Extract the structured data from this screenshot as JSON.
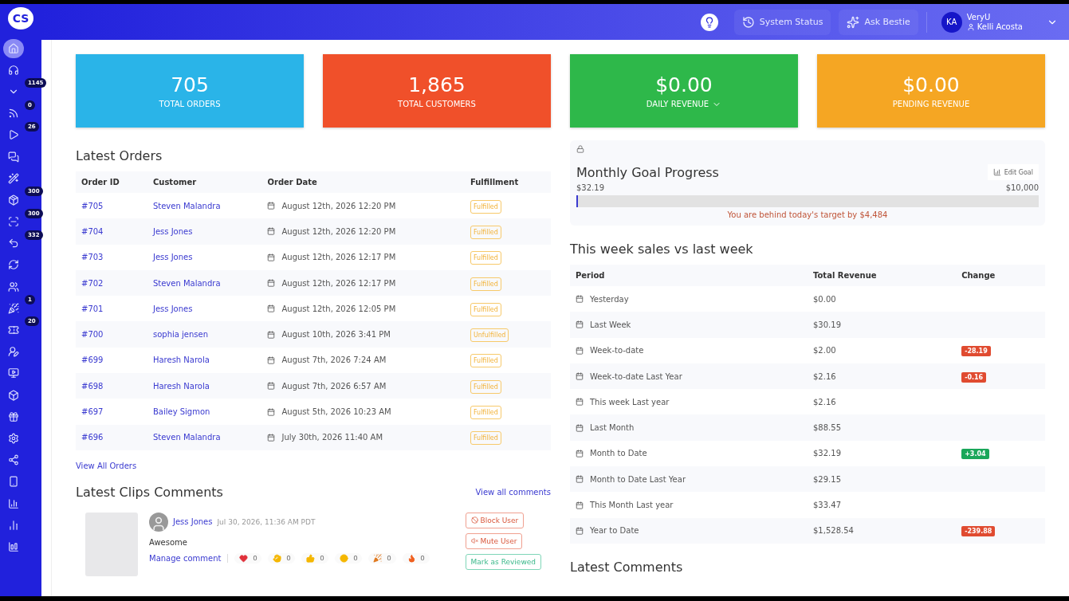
{
  "header": {
    "system_status": "System Status",
    "ask": "Ask Bestie",
    "user": {
      "initials": "KA",
      "org": "VeryU",
      "name": "Kelli Acosta"
    }
  },
  "sidebar": {
    "logo": "CS",
    "items": [
      {
        "selected": true
      },
      {
        "selected": false
      },
      {
        "selected": false,
        "badge": "1145"
      },
      {
        "selected": false,
        "badge": "0"
      },
      {
        "selected": false,
        "badge": "26"
      },
      {
        "selected": false
      },
      {
        "selected": false
      },
      {
        "selected": false,
        "badge": "300"
      },
      {
        "selected": false,
        "badge": "300"
      },
      {
        "selected": false,
        "badge": "332"
      },
      {
        "selected": false
      },
      {
        "selected": false
      },
      {
        "selected": false,
        "badge": "1"
      },
      {
        "selected": false,
        "badge": "20"
      },
      {
        "selected": false
      },
      {
        "selected": false
      },
      {
        "selected": false
      },
      {
        "selected": false
      },
      {
        "selected": false
      },
      {
        "selected": false
      },
      {
        "selected": false
      },
      {
        "selected": false
      },
      {
        "selected": false
      },
      {
        "selected": false
      }
    ]
  },
  "stats": [
    {
      "value": "705",
      "label": "TOTAL ORDERS",
      "color": "#2ab4e8",
      "dropdown": false
    },
    {
      "value": "1,865",
      "label": "TOTAL CUSTOMERS",
      "color": "#f0502a",
      "dropdown": false
    },
    {
      "value": "$0.00",
      "label": "DAILY REVENUE",
      "color": "#2eb84a",
      "dropdown": true
    },
    {
      "value": "$0.00",
      "label": "PENDING REVENUE",
      "color": "#f5a623",
      "dropdown": false
    }
  ],
  "latest_orders": {
    "title": "Latest Orders",
    "columns": [
      "Order ID",
      "Customer",
      "Order Date",
      "Fulfillment"
    ],
    "rows": [
      {
        "id": "#705",
        "customer": "Steven Malandra",
        "date": "August 12th, 2026 12:20 PM",
        "fulfillment": "Fulfilled"
      },
      {
        "id": "#704",
        "customer": "Jess Jones",
        "date": "August 12th, 2026 12:20 PM",
        "fulfillment": "Fulfilled"
      },
      {
        "id": "#703",
        "customer": "Jess Jones",
        "date": "August 12th, 2026 12:17 PM",
        "fulfillment": "Fulfilled"
      },
      {
        "id": "#702",
        "customer": "Steven Malandra",
        "date": "August 12th, 2026 12:17 PM",
        "fulfillment": "Fulfilled"
      },
      {
        "id": "#701",
        "customer": "Jess Jones",
        "date": "August 12th, 2026 12:05 PM",
        "fulfillment": "Fulfilled"
      },
      {
        "id": "#700",
        "customer": "sophia jensen",
        "date": "August 10th, 2026 3:41 PM",
        "fulfillment": "Unfulfilled"
      },
      {
        "id": "#699",
        "customer": "Haresh Narola",
        "date": "August 7th, 2026 7:24 AM",
        "fulfillment": "Fulfilled"
      },
      {
        "id": "#698",
        "customer": "Haresh Narola",
        "date": "August 7th, 2026 6:57 AM",
        "fulfillment": "Fulfilled"
      },
      {
        "id": "#697",
        "customer": "Bailey Sigmon",
        "date": "August 5th, 2026 10:23 AM",
        "fulfillment": "Fulfilled"
      },
      {
        "id": "#696",
        "customer": "Steven Malandra",
        "date": "July 30th, 2026 11:40 AM",
        "fulfillment": "Fulfilled"
      }
    ],
    "view_all": "View All Orders"
  },
  "clips_comments": {
    "title": "Latest Clips Comments",
    "view_all": "View all comments",
    "items": [
      {
        "author": "Jess Jones",
        "time": "Jul 30, 2026, 11:36 AM PDT",
        "text": "Awesome",
        "manage": "Manage comment",
        "reactions": [
          "0",
          "0",
          "0",
          "0",
          "0",
          "0"
        ],
        "actions": [
          "Block User",
          "Mute User",
          "Mark as Reviewed"
        ]
      }
    ]
  },
  "goal": {
    "title": "Monthly Goal Progress",
    "edit": "Edit Goal",
    "current": "$32.19",
    "target": "$10,000",
    "level": 0.0032,
    "message": "You are behind today's target by $4,484"
  },
  "weekly": {
    "title": "This week sales vs last week",
    "columns": [
      "Period",
      "Total Revenue",
      "Change"
    ],
    "rows": [
      {
        "period": "Yesterday",
        "revenue": "$0.00"
      },
      {
        "period": "Last Week",
        "revenue": "$30.19"
      },
      {
        "period": "Week-to-date",
        "revenue": "$2.00",
        "change": "-28.19",
        "color": "#e04b30"
      },
      {
        "period": "Week-to-date Last Year",
        "revenue": "$2.16",
        "change": "-0.16",
        "color": "#e04b30"
      },
      {
        "period": "This week Last year",
        "revenue": "$2.16"
      },
      {
        "period": "Last Month",
        "revenue": "$88.55"
      },
      {
        "period": "Month to Date",
        "revenue": "$32.19",
        "change": "+3.04",
        "color": "#1aa75a"
      },
      {
        "period": "Month to Date Last Year",
        "revenue": "$29.15"
      },
      {
        "period": "This Month Last year",
        "revenue": "$33.47"
      },
      {
        "period": "Year to Date",
        "revenue": "$1,528.54",
        "change": "-239.88",
        "color": "#e04b30"
      }
    ]
  },
  "latest_comments": {
    "title": "Latest Comments"
  }
}
